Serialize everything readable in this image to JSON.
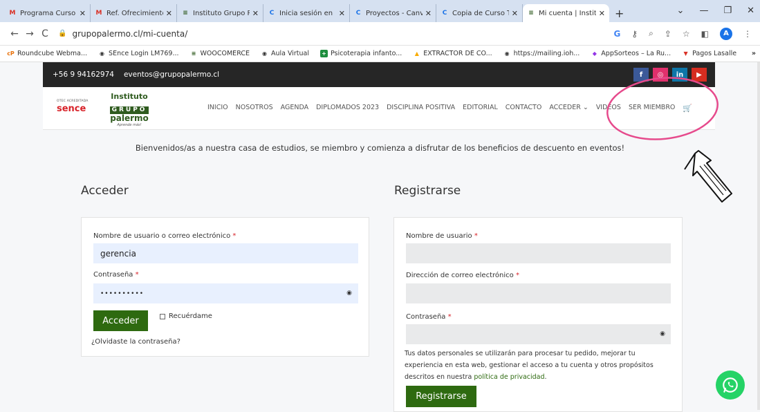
{
  "browser": {
    "tabs": [
      {
        "title": "Programa Curso",
        "fav": "M",
        "color": "#d93025"
      },
      {
        "title": "Ref. Ofrecimiento",
        "fav": "M",
        "color": "#d93025"
      },
      {
        "title": "Instituto Grupo P",
        "fav": "≡",
        "color": "#2f5b1f"
      },
      {
        "title": "Inicia sesión en",
        "fav": "C",
        "color": "#1a73e8"
      },
      {
        "title": "Proyectos - Canv",
        "fav": "C",
        "color": "#1a73e8"
      },
      {
        "title": "Copia de Curso T",
        "fav": "C",
        "color": "#1a73e8"
      },
      {
        "title": "Mi cuenta | Instit",
        "fav": "≡",
        "color": "#2f5b1f"
      }
    ],
    "new_tab": "+",
    "window_controls": [
      "⌄",
      "—",
      "❐",
      "✕"
    ],
    "url": "grupopalermo.cl/mi-cuenta/",
    "avatar_letter": "A",
    "bookmarks": [
      {
        "label": "Roundcube Webma...",
        "icon": "cP",
        "color": "#e8710a"
      },
      {
        "label": "SEnce Login LM769...",
        "icon": "◉",
        "color": "#333"
      },
      {
        "label": "WOOCOMERCE",
        "icon": "≡",
        "color": "#2f5b1f"
      },
      {
        "label": "Aula Virtual",
        "icon": "◉",
        "color": "#333"
      },
      {
        "label": "Psicoterapia infanto...",
        "icon": "+",
        "color": "#1e8e3e"
      },
      {
        "label": "EXTRACTOR DE CO...",
        "icon": "▲",
        "color": "#f9ab00"
      },
      {
        "label": "https://mailing.ioh...",
        "icon": "◉",
        "color": "#222"
      },
      {
        "label": "AppSorteos – La Ru...",
        "icon": "◆",
        "color": "#9334e6"
      },
      {
        "label": "Pagos Lasalle",
        "icon": "▼",
        "color": "#d93025"
      }
    ],
    "more_bookmarks": "»"
  },
  "site": {
    "phone": "+56 9 94162974",
    "email": "eventos@grupopalermo.cl",
    "social": [
      {
        "label": "f",
        "color": "#3b5998"
      },
      {
        "label": "◎",
        "color": "#e1306c"
      },
      {
        "label": "in",
        "color": "#0e76a8"
      },
      {
        "label": "▶",
        "color": "#d62d20"
      }
    ],
    "logo": {
      "sence_small": "OTEC ACREDITADA",
      "sence_word": "sence",
      "inst_line1": "Instituto",
      "inst_line2": "GRUPO",
      "inst_line3": "palermo",
      "inst_tagline": "Aprende más!"
    },
    "menu": [
      "INICIO",
      "NOSOTROS",
      "AGENDA",
      "DIPLOMADOS 2023",
      "DISCIPLINA POSITIVA",
      "EDITORIAL",
      "CONTACTO",
      "ACCEDER ⌄",
      "VIDEOS",
      "SER MIEMBRO"
    ],
    "welcome": "Bienvenidos/as a nuestra casa de estudios, se miembro y comienza a disfrutar de los beneficios de descuento en eventos!"
  },
  "login": {
    "title": "Acceder",
    "username_label": "Nombre de usuario o correo electrónico",
    "username_value": "gerencia",
    "password_label": "Contraseña",
    "password_value": "••••••••••",
    "submit": "Acceder",
    "remember": "Recuérdame",
    "forgot": "¿Olvidaste la contraseña?"
  },
  "register": {
    "title": "Registrarse",
    "username_label": "Nombre de usuario",
    "email_label": "Dirección de correo electrónico",
    "password_label": "Contraseña",
    "privacy_text_1": "Tus datos personales se utilizarán para procesar tu pedido, mejorar tu",
    "privacy_text_2": "experiencia en esta web, gestionar el acceso a tu cuenta y otros propósitos",
    "privacy_text_3": "descritos en nuestra",
    "privacy_link": "política de privacidad",
    "privacy_end": ".",
    "submit": "Registrarse"
  },
  "required_mark": "*"
}
